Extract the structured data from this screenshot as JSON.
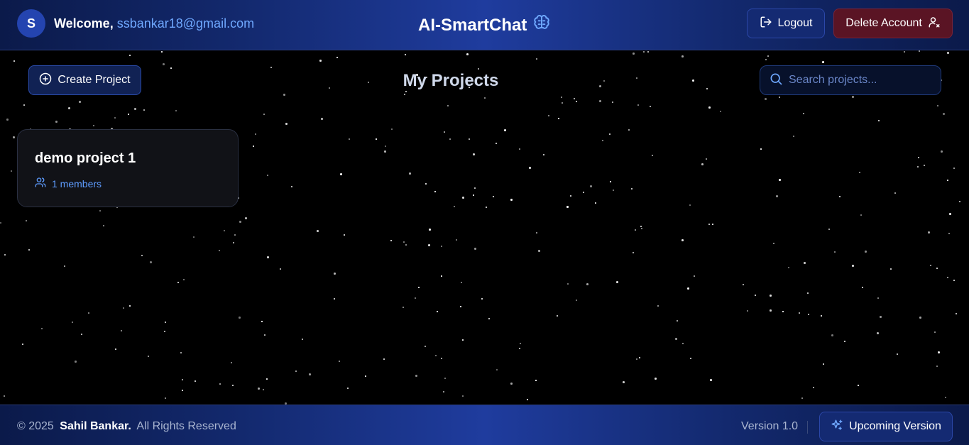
{
  "header": {
    "avatar_initial": "S",
    "welcome_label": "Welcome,",
    "user_email": "ssbankar18@gmail.com",
    "brand_title": "AI-SmartChat",
    "logout_label": "Logout",
    "delete_account_label": "Delete Account"
  },
  "toolbar": {
    "create_project_label": "Create Project",
    "page_title": "My Projects",
    "search_placeholder": "Search projects..."
  },
  "projects": [
    {
      "name": "demo project 1",
      "members_text": "1 members"
    }
  ],
  "footer": {
    "copyright_prefix": "© 2025",
    "author": "Sahil Bankar.",
    "rights": "All Rights Reserved",
    "version": "Version 1.0",
    "upcoming_label": "Upcoming Version"
  },
  "icons": {
    "brand": "brain-icon",
    "logout": "logout-icon",
    "delete": "user-x-icon",
    "create": "plus-circle-icon",
    "search": "search-icon",
    "members": "users-icon",
    "upcoming": "sparkles-icon"
  },
  "colors": {
    "accent": "#6fa8ff",
    "danger_bg": "#5a1424",
    "header_bg": "#1f3c9e"
  }
}
